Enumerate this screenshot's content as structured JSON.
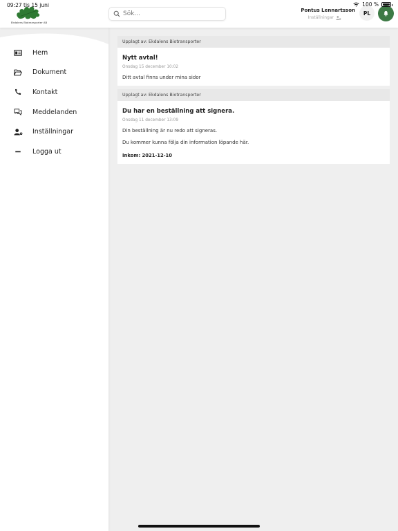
{
  "status_bar": {
    "time": "09:27",
    "date": "tis 15 juni",
    "battery": "100 %"
  },
  "header": {
    "logo_text": "Ekdalens Biotransporter AB",
    "search": {
      "placeholder": "Sök...",
      "value": ""
    },
    "user_name": "Pontus Lennartsson",
    "user_settings_label": "Inställningar",
    "avatar_initials": "PL",
    "accent_color": "#3d7a45"
  },
  "sidebar": {
    "items": [
      {
        "label": "Hem",
        "icon": "home-card-icon"
      },
      {
        "label": "Dokument",
        "icon": "folder-open-icon"
      },
      {
        "label": "Kontakt",
        "icon": "phone-icon"
      },
      {
        "label": "Meddelanden",
        "icon": "chat-bubbles-icon"
      },
      {
        "label": "Inställningar",
        "icon": "user-gear-icon"
      },
      {
        "label": "Logga ut",
        "icon": "minus-icon"
      }
    ]
  },
  "feed": [
    {
      "meta": "Upplagt av: Ekdalens Biotransporter",
      "title": "Nytt avtal!",
      "date": "Onsdag 15 december 10:02",
      "text": "Ditt avtal finns under mina sidor"
    },
    {
      "meta": "Upplagt av: Ekdalens Biotransporter",
      "title": "Du har en beställning att signera.",
      "date": "Onsdag 11 december 13:09",
      "text": "Din beställning är nu redo att signeras.",
      "text2": "Du kommer kunna följa din information löpande här.",
      "inkom": "Inkom: 2021-12-10"
    }
  ]
}
